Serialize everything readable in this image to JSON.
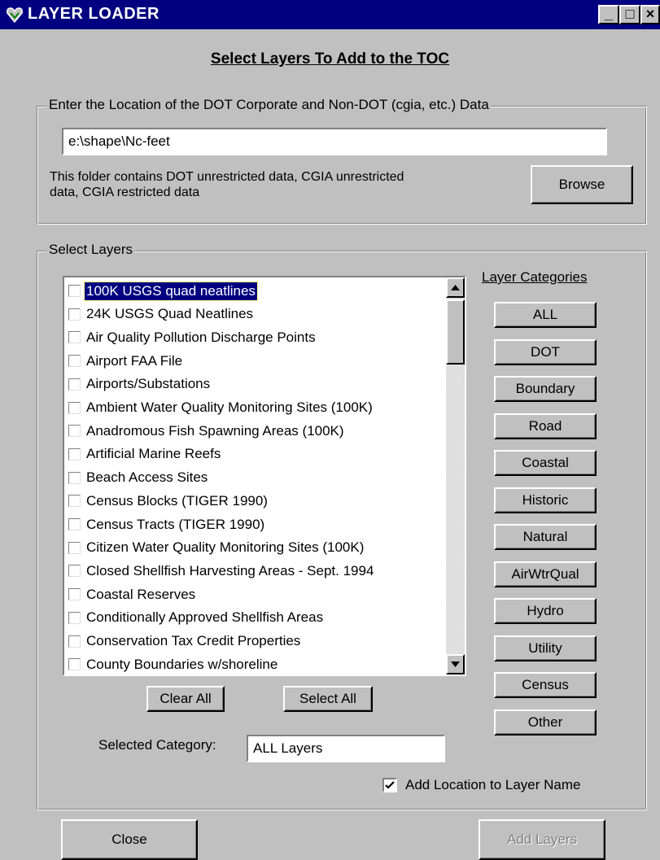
{
  "window": {
    "title": "LAYER LOADER",
    "minimize_glyph": "_",
    "maximize_glyph": "□",
    "close_glyph": "×"
  },
  "heading": "Select Layers To Add to the TOC",
  "location_group": {
    "label": "Enter the Location of the DOT Corporate and Non-DOT (cgia, etc.) Data",
    "path_value": "e:\\shape\\Nc-feet",
    "info_line1": "This folder contains DOT unrestricted data, CGIA unrestricted",
    "info_line2": "data, CGIA restricted data",
    "browse_label": "Browse"
  },
  "layers_group": {
    "label": "Select Layers",
    "items": [
      {
        "label": "100K USGS quad neatlines",
        "selected": true
      },
      {
        "label": "24K USGS Quad Neatlines"
      },
      {
        "label": "Air Quality Pollution Discharge Points"
      },
      {
        "label": "Airport FAA File"
      },
      {
        "label": "Airports/Substations"
      },
      {
        "label": "Ambient Water Quality Monitoring Sites (100K)"
      },
      {
        "label": "Anadromous Fish Spawning Areas (100K)"
      },
      {
        "label": "Artificial Marine Reefs"
      },
      {
        "label": "Beach Access Sites"
      },
      {
        "label": "Census Blocks (TIGER 1990)"
      },
      {
        "label": "Census Tracts (TIGER 1990)"
      },
      {
        "label": "Citizen Water Quality Monitoring Sites (100K)"
      },
      {
        "label": "Closed Shellfish Harvesting Areas - Sept. 1994"
      },
      {
        "label": "Coastal Reserves"
      },
      {
        "label": "Conditionally Approved Shellfish Areas"
      },
      {
        "label": "Conservation Tax Credit Properties"
      },
      {
        "label": "County Boundaries  w/shoreline"
      }
    ],
    "clear_all_label": "Clear All",
    "select_all_label": "Select All",
    "selected_category_label": "Selected Category:",
    "selected_category_value": "ALL Layers",
    "add_location_label": "Add Location to Layer Name",
    "add_location_checked": true
  },
  "categories": {
    "title": "Layer Categories",
    "buttons": [
      "ALL",
      "DOT",
      "Boundary",
      "Road",
      "Coastal",
      "Historic",
      "Natural",
      "AirWtrQual",
      "Hydro",
      "Utility",
      "Census",
      "Other"
    ]
  },
  "footer": {
    "close_label": "Close",
    "add_layers_label": "Add Layers"
  },
  "colors": {
    "titlebar": "#000080",
    "face": "#c0c0c0",
    "selection": "#000080"
  }
}
